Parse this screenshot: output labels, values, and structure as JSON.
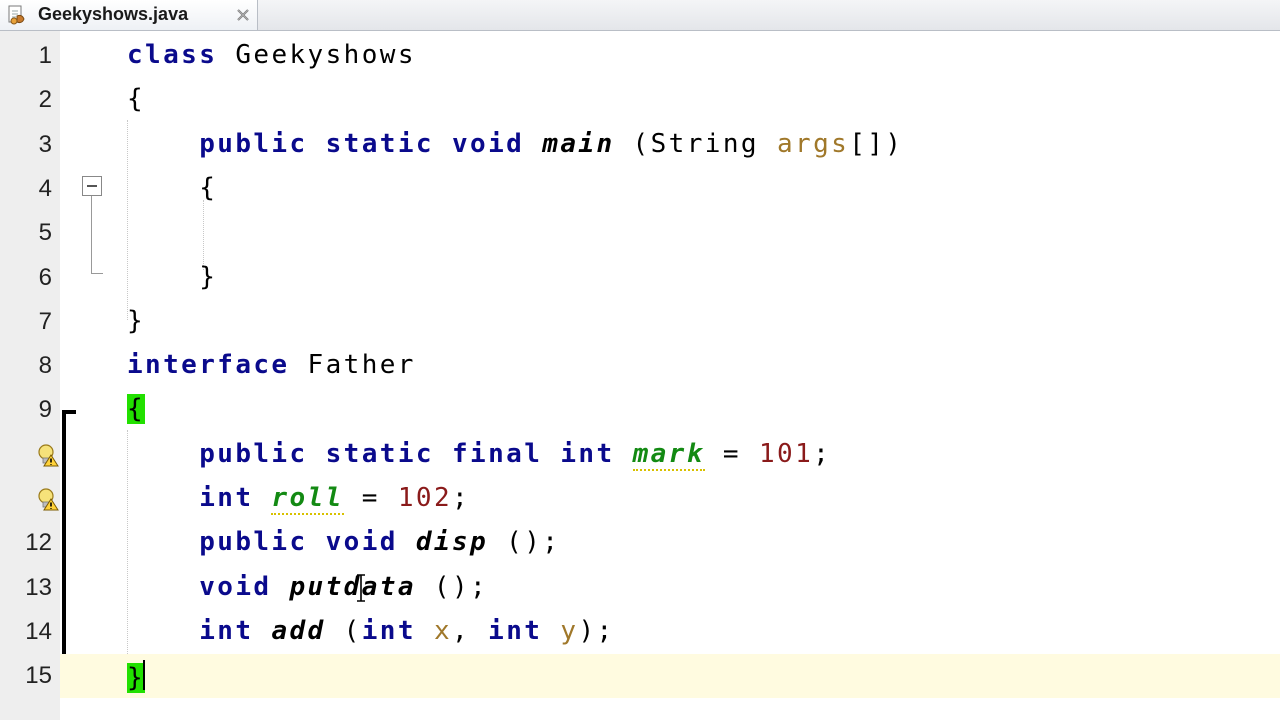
{
  "tab": {
    "title": "Geekyshows.java",
    "icon": "java-file-icon",
    "close_icon": "close-icon"
  },
  "editor": {
    "lines": [
      {
        "n": "1",
        "code": [
          {
            "c": "kw",
            "t": "class"
          },
          {
            "c": "plain",
            "t": " Geekyshows"
          }
        ]
      },
      {
        "n": "2",
        "code": [
          {
            "c": "plain",
            "t": "{"
          }
        ]
      },
      {
        "n": "3",
        "code": [
          {
            "c": "plain",
            "t": "    "
          },
          {
            "c": "kw",
            "t": "public"
          },
          {
            "c": "plain",
            "t": " "
          },
          {
            "c": "kw",
            "t": "static"
          },
          {
            "c": "plain",
            "t": " "
          },
          {
            "c": "kw",
            "t": "void"
          },
          {
            "c": "plain",
            "t": " "
          },
          {
            "c": "ital",
            "t": "main"
          },
          {
            "c": "plain",
            "t": " (String "
          },
          {
            "c": "param",
            "t": "args"
          },
          {
            "c": "plain",
            "t": "[])"
          }
        ]
      },
      {
        "n": "4",
        "code": [
          {
            "c": "plain",
            "t": "    {"
          }
        ]
      },
      {
        "n": "5",
        "code": []
      },
      {
        "n": "6",
        "code": [
          {
            "c": "plain",
            "t": "    }"
          }
        ]
      },
      {
        "n": "7",
        "code": [
          {
            "c": "plain",
            "t": "}"
          }
        ]
      },
      {
        "n": "8",
        "code": [
          {
            "c": "kw",
            "t": "interface"
          },
          {
            "c": "plain",
            "t": " Father"
          }
        ]
      },
      {
        "n": "9",
        "code": [
          {
            "c": "brace-match",
            "t": "{"
          }
        ]
      },
      {
        "n": "",
        "warn": true,
        "code": [
          {
            "c": "plain",
            "t": "    "
          },
          {
            "c": "kw",
            "t": "public"
          },
          {
            "c": "plain",
            "t": " "
          },
          {
            "c": "kw",
            "t": "static"
          },
          {
            "c": "plain",
            "t": " "
          },
          {
            "c": "kw",
            "t": "final"
          },
          {
            "c": "plain",
            "t": " "
          },
          {
            "c": "ty",
            "t": "int"
          },
          {
            "c": "plain",
            "t": " "
          },
          {
            "c": "field",
            "t": "mark"
          },
          {
            "c": "plain",
            "t": " = "
          },
          {
            "c": "num",
            "t": "101"
          },
          {
            "c": "plain",
            "t": ";"
          }
        ]
      },
      {
        "n": "",
        "warn": true,
        "code": [
          {
            "c": "plain",
            "t": "    "
          },
          {
            "c": "ty",
            "t": "int"
          },
          {
            "c": "plain",
            "t": " "
          },
          {
            "c": "field",
            "t": "roll"
          },
          {
            "c": "plain",
            "t": " = "
          },
          {
            "c": "num",
            "t": "102"
          },
          {
            "c": "plain",
            "t": ";"
          }
        ]
      },
      {
        "n": "12",
        "code": [
          {
            "c": "plain",
            "t": "    "
          },
          {
            "c": "kw",
            "t": "public"
          },
          {
            "c": "plain",
            "t": " "
          },
          {
            "c": "kw",
            "t": "void"
          },
          {
            "c": "plain",
            "t": " "
          },
          {
            "c": "ital",
            "t": "disp"
          },
          {
            "c": "plain",
            "t": " ();"
          }
        ]
      },
      {
        "n": "13",
        "code": [
          {
            "c": "plain",
            "t": "    "
          },
          {
            "c": "kw",
            "t": "void"
          },
          {
            "c": "plain",
            "t": " "
          },
          {
            "c": "ital",
            "t": "putdata"
          },
          {
            "c": "plain",
            "t": " ();"
          }
        ]
      },
      {
        "n": "14",
        "code": [
          {
            "c": "plain",
            "t": "    "
          },
          {
            "c": "ty",
            "t": "int"
          },
          {
            "c": "plain",
            "t": " "
          },
          {
            "c": "ital",
            "t": "add"
          },
          {
            "c": "plain",
            "t": " ("
          },
          {
            "c": "ty",
            "t": "int"
          },
          {
            "c": "plain",
            "t": " "
          },
          {
            "c": "param",
            "t": "x"
          },
          {
            "c": "plain",
            "t": ", "
          },
          {
            "c": "ty",
            "t": "int"
          },
          {
            "c": "plain",
            "t": " "
          },
          {
            "c": "param",
            "t": "y"
          },
          {
            "c": "plain",
            "t": ");"
          }
        ]
      },
      {
        "n": "15",
        "current": true,
        "code": [
          {
            "c": "brace-match",
            "t": "}"
          }
        ]
      }
    ]
  },
  "colors": {
    "keyword": "#0a0a8c",
    "field": "#138a13",
    "number": "#8a1a1a",
    "parameter": "#a0782a",
    "brace_match": "#22e000",
    "current_line": "#fffbe0"
  }
}
